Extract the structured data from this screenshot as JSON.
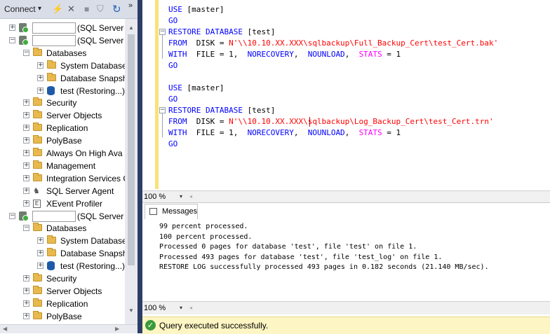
{
  "object_explorer": {
    "toolbar": {
      "connect_label": "Connect",
      "dropdown_glyph": "▾",
      "refresh_glyph": "↻",
      "overflow_glyph": "»"
    },
    "tree": [
      {
        "label": "(SQL Server",
        "kind": "server",
        "state": "collapsed",
        "redacted_name": true
      },
      {
        "label": "(SQL Server",
        "kind": "server",
        "state": "expanded",
        "redacted_name": true
      },
      {
        "label": "Databases",
        "kind": "folder",
        "state": "expanded"
      },
      {
        "label": "System Database",
        "kind": "folder",
        "state": "collapsed"
      },
      {
        "label": "Database Snapsh",
        "kind": "folder",
        "state": "collapsed"
      },
      {
        "label": "test (Restoring...)",
        "kind": "database",
        "state": "collapsed"
      },
      {
        "label": "Security",
        "kind": "folder",
        "state": "collapsed"
      },
      {
        "label": "Server Objects",
        "kind": "folder",
        "state": "collapsed"
      },
      {
        "label": "Replication",
        "kind": "folder",
        "state": "collapsed"
      },
      {
        "label": "PolyBase",
        "kind": "folder",
        "state": "collapsed"
      },
      {
        "label": "Always On High Ava",
        "kind": "folder",
        "state": "collapsed"
      },
      {
        "label": "Management",
        "kind": "folder",
        "state": "collapsed"
      },
      {
        "label": "Integration Services C",
        "kind": "folder",
        "state": "collapsed"
      },
      {
        "label": "SQL Server Agent",
        "kind": "agent",
        "state": "collapsed"
      },
      {
        "label": "XEvent Profiler",
        "kind": "xevent",
        "state": "collapsed"
      },
      {
        "label": "(SQL Server",
        "kind": "server",
        "state": "expanded",
        "redacted_name": true
      },
      {
        "label": "Databases",
        "kind": "folder",
        "state": "expanded"
      },
      {
        "label": "System Database",
        "kind": "folder",
        "state": "collapsed"
      },
      {
        "label": "Database Snapsh",
        "kind": "folder",
        "state": "collapsed"
      },
      {
        "label": "test (Restoring...)",
        "kind": "database",
        "state": "collapsed"
      },
      {
        "label": "Security",
        "kind": "folder",
        "state": "collapsed"
      },
      {
        "label": "Server Objects",
        "kind": "folder",
        "state": "collapsed"
      },
      {
        "label": "Replication",
        "kind": "folder",
        "state": "collapsed"
      },
      {
        "label": "PolyBase",
        "kind": "folder",
        "state": "collapsed"
      }
    ]
  },
  "editor": {
    "lines": [
      [
        {
          "t": "USE",
          "c": "kw"
        },
        {
          "t": " [master]",
          "c": "plain"
        }
      ],
      [
        {
          "t": "GO",
          "c": "kw"
        }
      ],
      [
        {
          "t": "RESTORE DATABASE",
          "c": "kw"
        },
        {
          "t": " [test]",
          "c": "plain"
        }
      ],
      [
        {
          "t": "FROM",
          "c": "kw"
        },
        {
          "t": "  DISK = ",
          "c": "plain"
        },
        {
          "t": "N'\\\\10.10.XX.XXX\\sqlbackup\\Full_Backup_Cert\\test_Cert.bak'",
          "c": "str"
        }
      ],
      [
        {
          "t": "WITH",
          "c": "kw"
        },
        {
          "t": "  FILE = 1,  ",
          "c": "plain"
        },
        {
          "t": "NORECOVERY",
          "c": "kw"
        },
        {
          "t": ",  ",
          "c": "plain"
        },
        {
          "t": "NOUNLOAD",
          "c": "kw"
        },
        {
          "t": ",  ",
          "c": "plain"
        },
        {
          "t": "STATS",
          "c": "kw2"
        },
        {
          "t": " = 1",
          "c": "plain"
        }
      ],
      [
        {
          "t": "GO",
          "c": "kw"
        }
      ],
      [],
      [
        {
          "t": "USE",
          "c": "kw"
        },
        {
          "t": " [master]",
          "c": "plain"
        }
      ],
      [
        {
          "t": "GO",
          "c": "kw"
        }
      ],
      [
        {
          "t": "RESTORE DATABASE",
          "c": "kw"
        },
        {
          "t": " [test]",
          "c": "plain"
        }
      ],
      [
        {
          "t": "FROM",
          "c": "kw"
        },
        {
          "t": "  DISK = ",
          "c": "plain"
        },
        {
          "t": "N'\\\\10.10.XX.XXX\\sqlbackup\\Log_Backup_Cert\\test_Cert.trn'",
          "c": "str"
        }
      ],
      [
        {
          "t": "WITH",
          "c": "kw"
        },
        {
          "t": "  FILE = 1,  ",
          "c": "plain"
        },
        {
          "t": "NORECOVERY",
          "c": "kw"
        },
        {
          "t": ",  ",
          "c": "plain"
        },
        {
          "t": "NOUNLOAD",
          "c": "kw"
        },
        {
          "t": ",  ",
          "c": "plain"
        },
        {
          "t": "STATS",
          "c": "kw2"
        },
        {
          "t": " = 1",
          "c": "plain"
        }
      ],
      [
        {
          "t": "GO",
          "c": "kw"
        }
      ]
    ],
    "zoom": "100 %"
  },
  "results": {
    "tab_label": "Messages",
    "messages": [
      "99 percent processed.",
      "100 percent processed.",
      "Processed 0 pages for database 'test', file 'test' on file 1.",
      "Processed 493 pages for database 'test', file 'test_log' on file 1.",
      "RESTORE LOG successfully processed 493 pages in 0.182 seconds (21.140 MB/sec)."
    ],
    "zoom": "100 %"
  },
  "status": {
    "text": "Query executed successfully."
  },
  "colors": {
    "keyword": "#0000ff",
    "keyword_alt": "#ff00ff",
    "string": "#ff0000",
    "status_bg": "#fdf5c3",
    "success": "#3b9b3b"
  }
}
